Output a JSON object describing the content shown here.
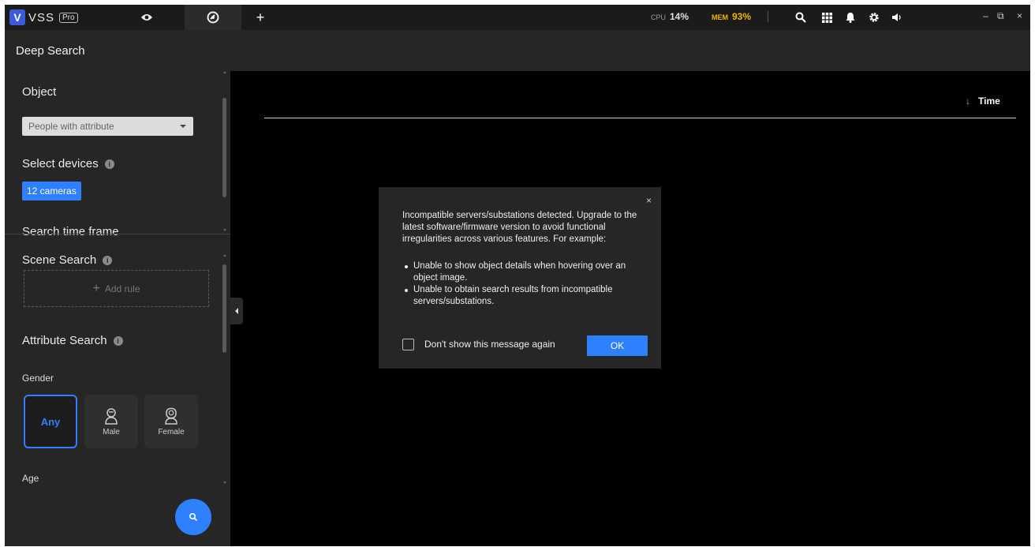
{
  "app": {
    "name": "VSS",
    "edition": "Pro",
    "logo_letter": "V"
  },
  "tabs": {
    "add_label": "+"
  },
  "status": {
    "cpu_label": "CPU",
    "cpu_value": "14%",
    "mem_label": "MEM",
    "mem_value": "93%",
    "mem_color": "#f0b400"
  },
  "toolbar_icons": [
    "search-icon",
    "grid-icon",
    "bell-icon",
    "settings-icon",
    "volume-icon"
  ],
  "window": {
    "minimize": "–",
    "restore": "⧉",
    "close": "×"
  },
  "page": {
    "title": "Deep Search"
  },
  "sidebar": {
    "object_title": "Object",
    "object_select": "People with attribute",
    "devices_title": "Select devices",
    "devices_button": "12 cameras",
    "timeframe_title": "Search time frame",
    "scene_title": "Scene Search",
    "add_rule": "Add rule",
    "attribute_title": "Attribute Search",
    "gender_label": "Gender",
    "gender_options": [
      "Any",
      "Male",
      "Female"
    ],
    "gender_selected": "Any",
    "age_label": "Age"
  },
  "main": {
    "sort_label": "Time",
    "sort_arrow": "↓"
  },
  "dialog": {
    "close": "×",
    "message": "Incompatible servers/substations detected. Upgrade to the latest software/firmware version to avoid functional irregularities across various features. For example:",
    "items": [
      "Unable to show object details when hovering over an object image.",
      "Unable to obtain search results from incompatible servers/substations."
    ],
    "checkbox_label": "Don't show this message again",
    "checkbox_checked": false,
    "ok_label": "OK"
  },
  "colors": {
    "accent": "#2f80ff",
    "background": "#000000",
    "panel": "#262626"
  }
}
